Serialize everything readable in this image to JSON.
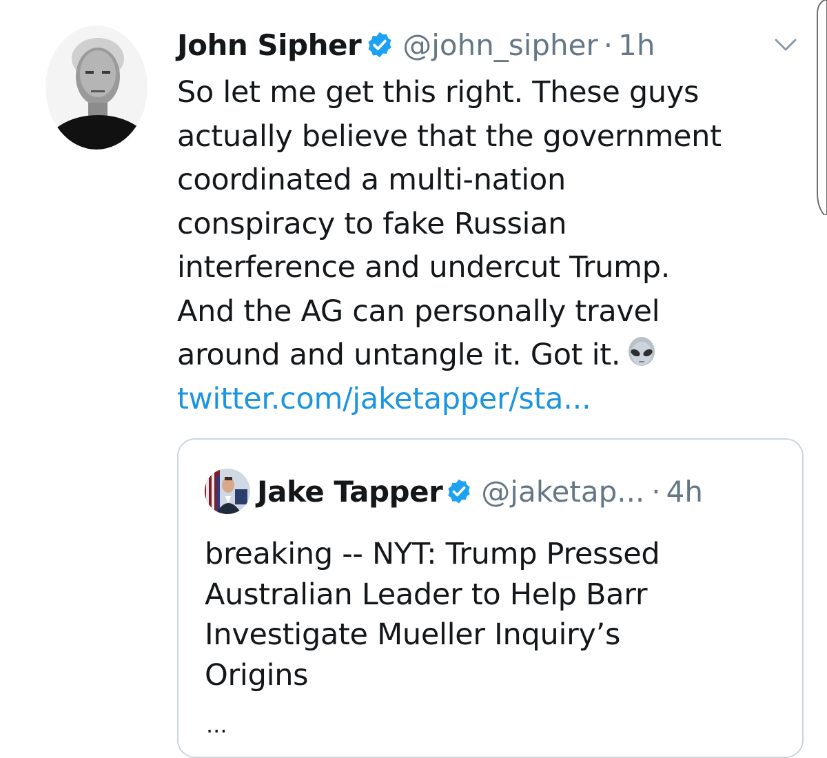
{
  "tweet": {
    "author": {
      "display_name": "John Sipher",
      "handle": "@john_sipher",
      "verified": true
    },
    "separator": "·",
    "time": "1h",
    "menu_icon": "chevron-down-icon",
    "text_lines": [
      "So let me get this right. These guys",
      "actually believe that the government",
      "coordinated a multi-nation",
      "conspiracy to fake Russian",
      "interference and undercut Trump.",
      "And the AG can personally travel",
      "around and untangle it. Got it."
    ],
    "emoji": "alien-emoji",
    "link": "twitter.com/jaketapper/sta..."
  },
  "quoted_tweet": {
    "author": {
      "display_name": "Jake Tapper",
      "handle": "@jaketap...",
      "verified": true
    },
    "separator": "·",
    "time": "4h",
    "text_lines": [
      "breaking -- NYT: Trump Pressed",
      "Australian Leader to Help Barr",
      "Investigate Mueller Inquiry’s",
      "Origins"
    ],
    "ellipsis": "..."
  },
  "colors": {
    "text_primary": "#14171a",
    "text_secondary": "#657786",
    "link": "#1b95e0",
    "verified_badge": "#1da1f2",
    "border": "#ccd6dd"
  }
}
